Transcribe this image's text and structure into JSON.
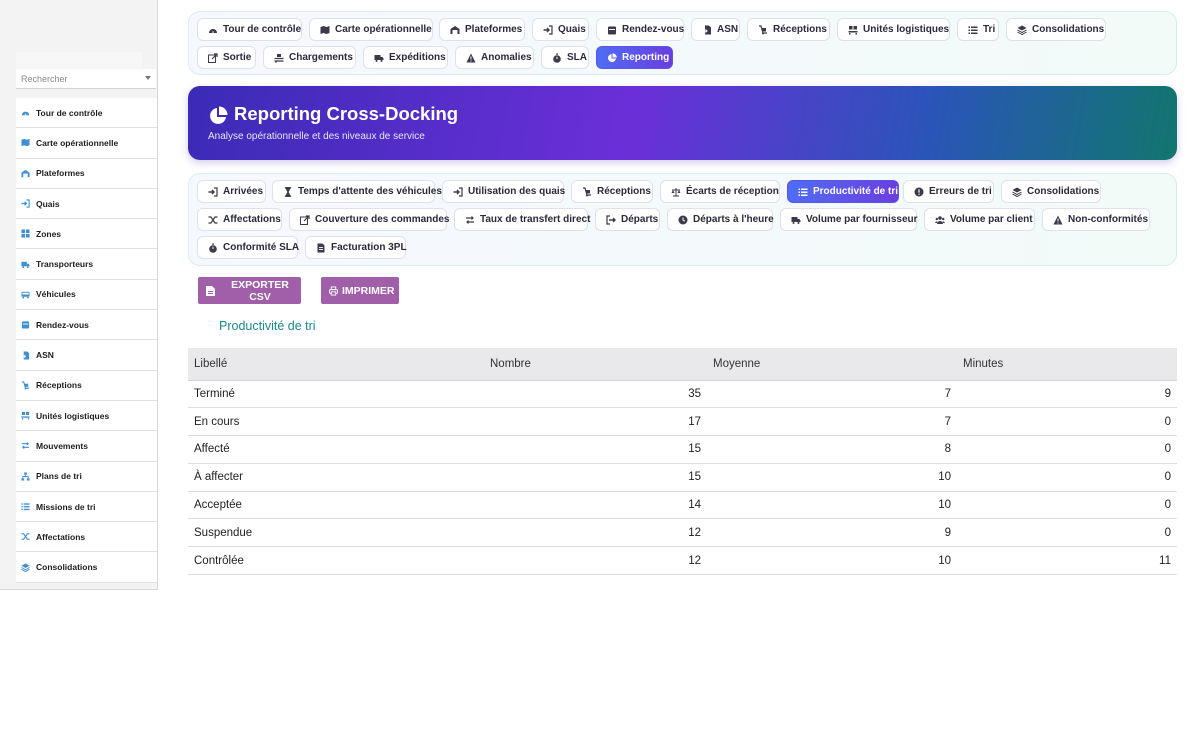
{
  "sidebar": {
    "search_placeholder": "Rechercher",
    "items": [
      {
        "label": "Tour de contrôle",
        "icon": "dashboard-icon"
      },
      {
        "label": "Carte opérationnelle",
        "icon": "map-icon"
      },
      {
        "label": "Plateformes",
        "icon": "warehouse-icon"
      },
      {
        "label": "Quais",
        "icon": "sign-in-icon"
      },
      {
        "label": "Zones",
        "icon": "grid-icon"
      },
      {
        "label": "Transporteurs",
        "icon": "truck-icon"
      },
      {
        "label": "Véhicules",
        "icon": "bus-icon"
      },
      {
        "label": "Rendez-vous",
        "icon": "calendar-icon"
      },
      {
        "label": "ASN",
        "icon": "file-import-icon"
      },
      {
        "label": "Réceptions",
        "icon": "dolly-icon"
      },
      {
        "label": "Unités logistiques",
        "icon": "pallet-icon"
      },
      {
        "label": "Mouvements",
        "icon": "exchange-icon"
      },
      {
        "label": "Plans de tri",
        "icon": "sitemap-icon"
      },
      {
        "label": "Missions de tri",
        "icon": "list-icon"
      },
      {
        "label": "Affectations",
        "icon": "shuffle-icon"
      },
      {
        "label": "Consolidations",
        "icon": "layers-icon"
      }
    ]
  },
  "topnav": [
    {
      "label": "Tour de contrôle",
      "icon": "dashboard-icon"
    },
    {
      "label": "Carte opérationnelle",
      "icon": "map-icon"
    },
    {
      "label": "Plateformes",
      "icon": "warehouse-icon"
    },
    {
      "label": "Quais",
      "icon": "sign-in-icon"
    },
    {
      "label": "Rendez-vous",
      "icon": "calendar-icon"
    },
    {
      "label": "ASN",
      "icon": "file-import-icon"
    },
    {
      "label": "Réceptions",
      "icon": "dolly-icon"
    },
    {
      "label": "Unités logistiques",
      "icon": "pallet-icon"
    },
    {
      "label": "Tri",
      "icon": "list-icon"
    },
    {
      "label": "Consolidations",
      "icon": "layers-icon"
    },
    {
      "label": "Sortie",
      "icon": "export-icon"
    },
    {
      "label": "Chargements",
      "icon": "truck-loading-icon"
    },
    {
      "label": "Expéditions",
      "icon": "truck-icon"
    },
    {
      "label": "Anomalies",
      "icon": "warning-icon"
    },
    {
      "label": "SLA",
      "icon": "stopwatch-icon"
    },
    {
      "label": "Reporting",
      "icon": "pie-chart-icon",
      "active": true
    }
  ],
  "hero": {
    "title": "Reporting Cross-Docking",
    "subtitle": "Analyse opérationnelle et des niveaux de service",
    "icon": "pie-chart-icon"
  },
  "subnav": [
    {
      "label": "Arrivées",
      "icon": "sign-in-icon"
    },
    {
      "label": "Temps d'attente des véhicules",
      "icon": "hourglass-icon"
    },
    {
      "label": "Utilisation des quais",
      "icon": "sign-in-icon"
    },
    {
      "label": "Réceptions",
      "icon": "dolly-icon"
    },
    {
      "label": "Écarts de réception",
      "icon": "balance-icon"
    },
    {
      "label": "Productivité de tri",
      "icon": "list-icon",
      "active": true
    },
    {
      "label": "Erreurs de tri",
      "icon": "alert-circle-icon"
    },
    {
      "label": "Consolidations",
      "icon": "layers-icon"
    },
    {
      "label": "Affectations",
      "icon": "shuffle-icon"
    },
    {
      "label": "Couverture des commandes",
      "icon": "export-icon"
    },
    {
      "label": "Taux de transfert direct",
      "icon": "exchange-icon"
    },
    {
      "label": "Départs",
      "icon": "sign-out-icon"
    },
    {
      "label": "Départs à l'heure",
      "icon": "clock-icon"
    },
    {
      "label": "Volume par fournisseur",
      "icon": "truck-icon"
    },
    {
      "label": "Volume par client",
      "icon": "users-icon"
    },
    {
      "label": "Non-conformités",
      "icon": "warning-icon"
    },
    {
      "label": "Conformité SLA",
      "icon": "stopwatch-icon"
    },
    {
      "label": "Facturation 3PL",
      "icon": "invoice-icon"
    }
  ],
  "actions": {
    "export_label": "EXPORTER CSV",
    "print_label": "IMPRIMER"
  },
  "report_title": "Productivité de tri",
  "table": {
    "headers": [
      "Libellé",
      "Nombre",
      "Moyenne",
      "Minutes"
    ],
    "rows": [
      [
        "Terminé",
        "35",
        "7",
        "9"
      ],
      [
        "En cours",
        "17",
        "7",
        "0"
      ],
      [
        "Affecté",
        "15",
        "8",
        "0"
      ],
      [
        "À affecter",
        "15",
        "10",
        "0"
      ],
      [
        "Acceptée",
        "14",
        "10",
        "0"
      ],
      [
        "Suspendue",
        "12",
        "9",
        "0"
      ],
      [
        "Contrôlée",
        "12",
        "10",
        "11"
      ]
    ]
  },
  "colors": {
    "accent": "#5b52ee",
    "button": "#a05fa8",
    "title_teal": "#198a8f"
  }
}
